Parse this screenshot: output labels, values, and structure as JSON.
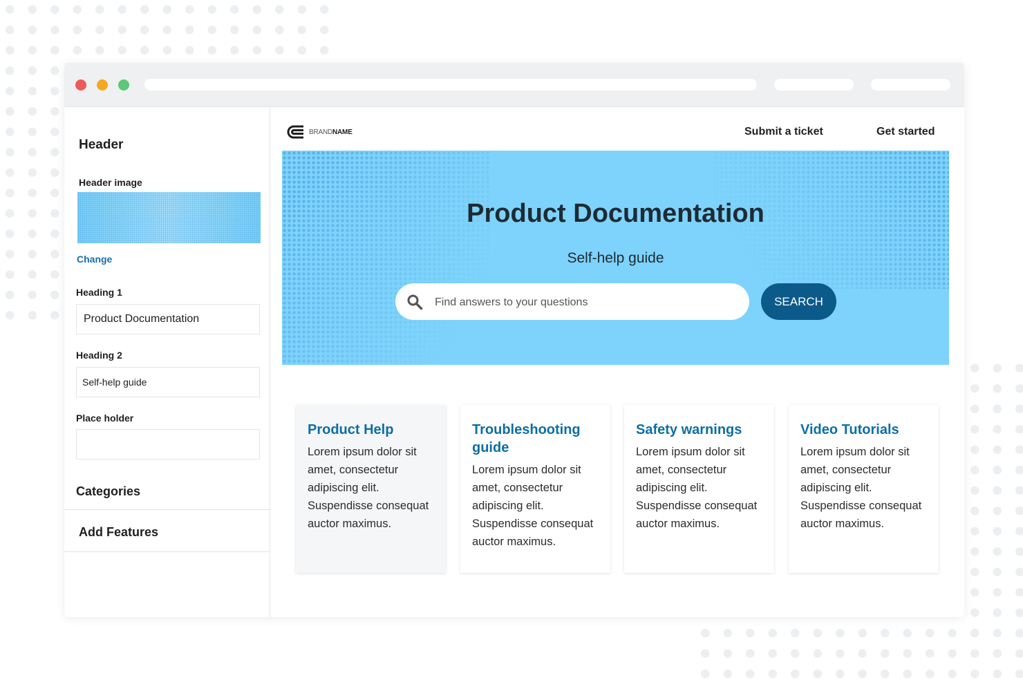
{
  "colors": {
    "page_bg": "#ffffff",
    "hero_bg": "#7dd3fb",
    "accent_blue": "#0d6ea3",
    "search_button_bg": "#0c5a8a",
    "traffic_red": "#ee5a57",
    "traffic_yellow": "#f5a623",
    "traffic_green": "#5cc776"
  },
  "sidebar": {
    "title": "Header",
    "header_image_label": "Header image",
    "change_link": "Change",
    "heading1_label": "Heading 1",
    "heading1_value": "Product Documentation",
    "heading2_label": "Heading 2",
    "heading2_value": "Self-help guide",
    "placeholder_label": "Place holder",
    "placeholder_value": "",
    "sections": [
      "Categories",
      "Add Features"
    ]
  },
  "main": {
    "logo": {
      "icon": "brand-logo-icon",
      "light": "BRAND",
      "bold": "NAME"
    },
    "nav": [
      "Submit a ticket",
      "Get started"
    ],
    "hero": {
      "title": "Product Documentation",
      "subtitle": "Self-help guide",
      "search_icon": "search-icon",
      "search_placeholder": "Find answers to your questions",
      "search_button": "SEARCH"
    },
    "cards": [
      {
        "title": "Product Help",
        "body": "Lorem ipsum dolor sit amet, consectetur adipiscing elit. Suspendisse consequat auctor maximus."
      },
      {
        "title": "Troubleshooting guide",
        "body": "Lorem ipsum dolor sit amet, consectetur adipiscing elit. Suspendisse consequat auctor maximus."
      },
      {
        "title": "Safety warnings",
        "body": "Lorem ipsum dolor sit amet, consectetur adipiscing elit. Suspendisse consequat auctor maximus."
      },
      {
        "title": "Video Tutorials",
        "body": "Lorem ipsum dolor sit amet, consectetur adipiscing elit. Suspendisse consequat auctor maximus."
      }
    ]
  }
}
